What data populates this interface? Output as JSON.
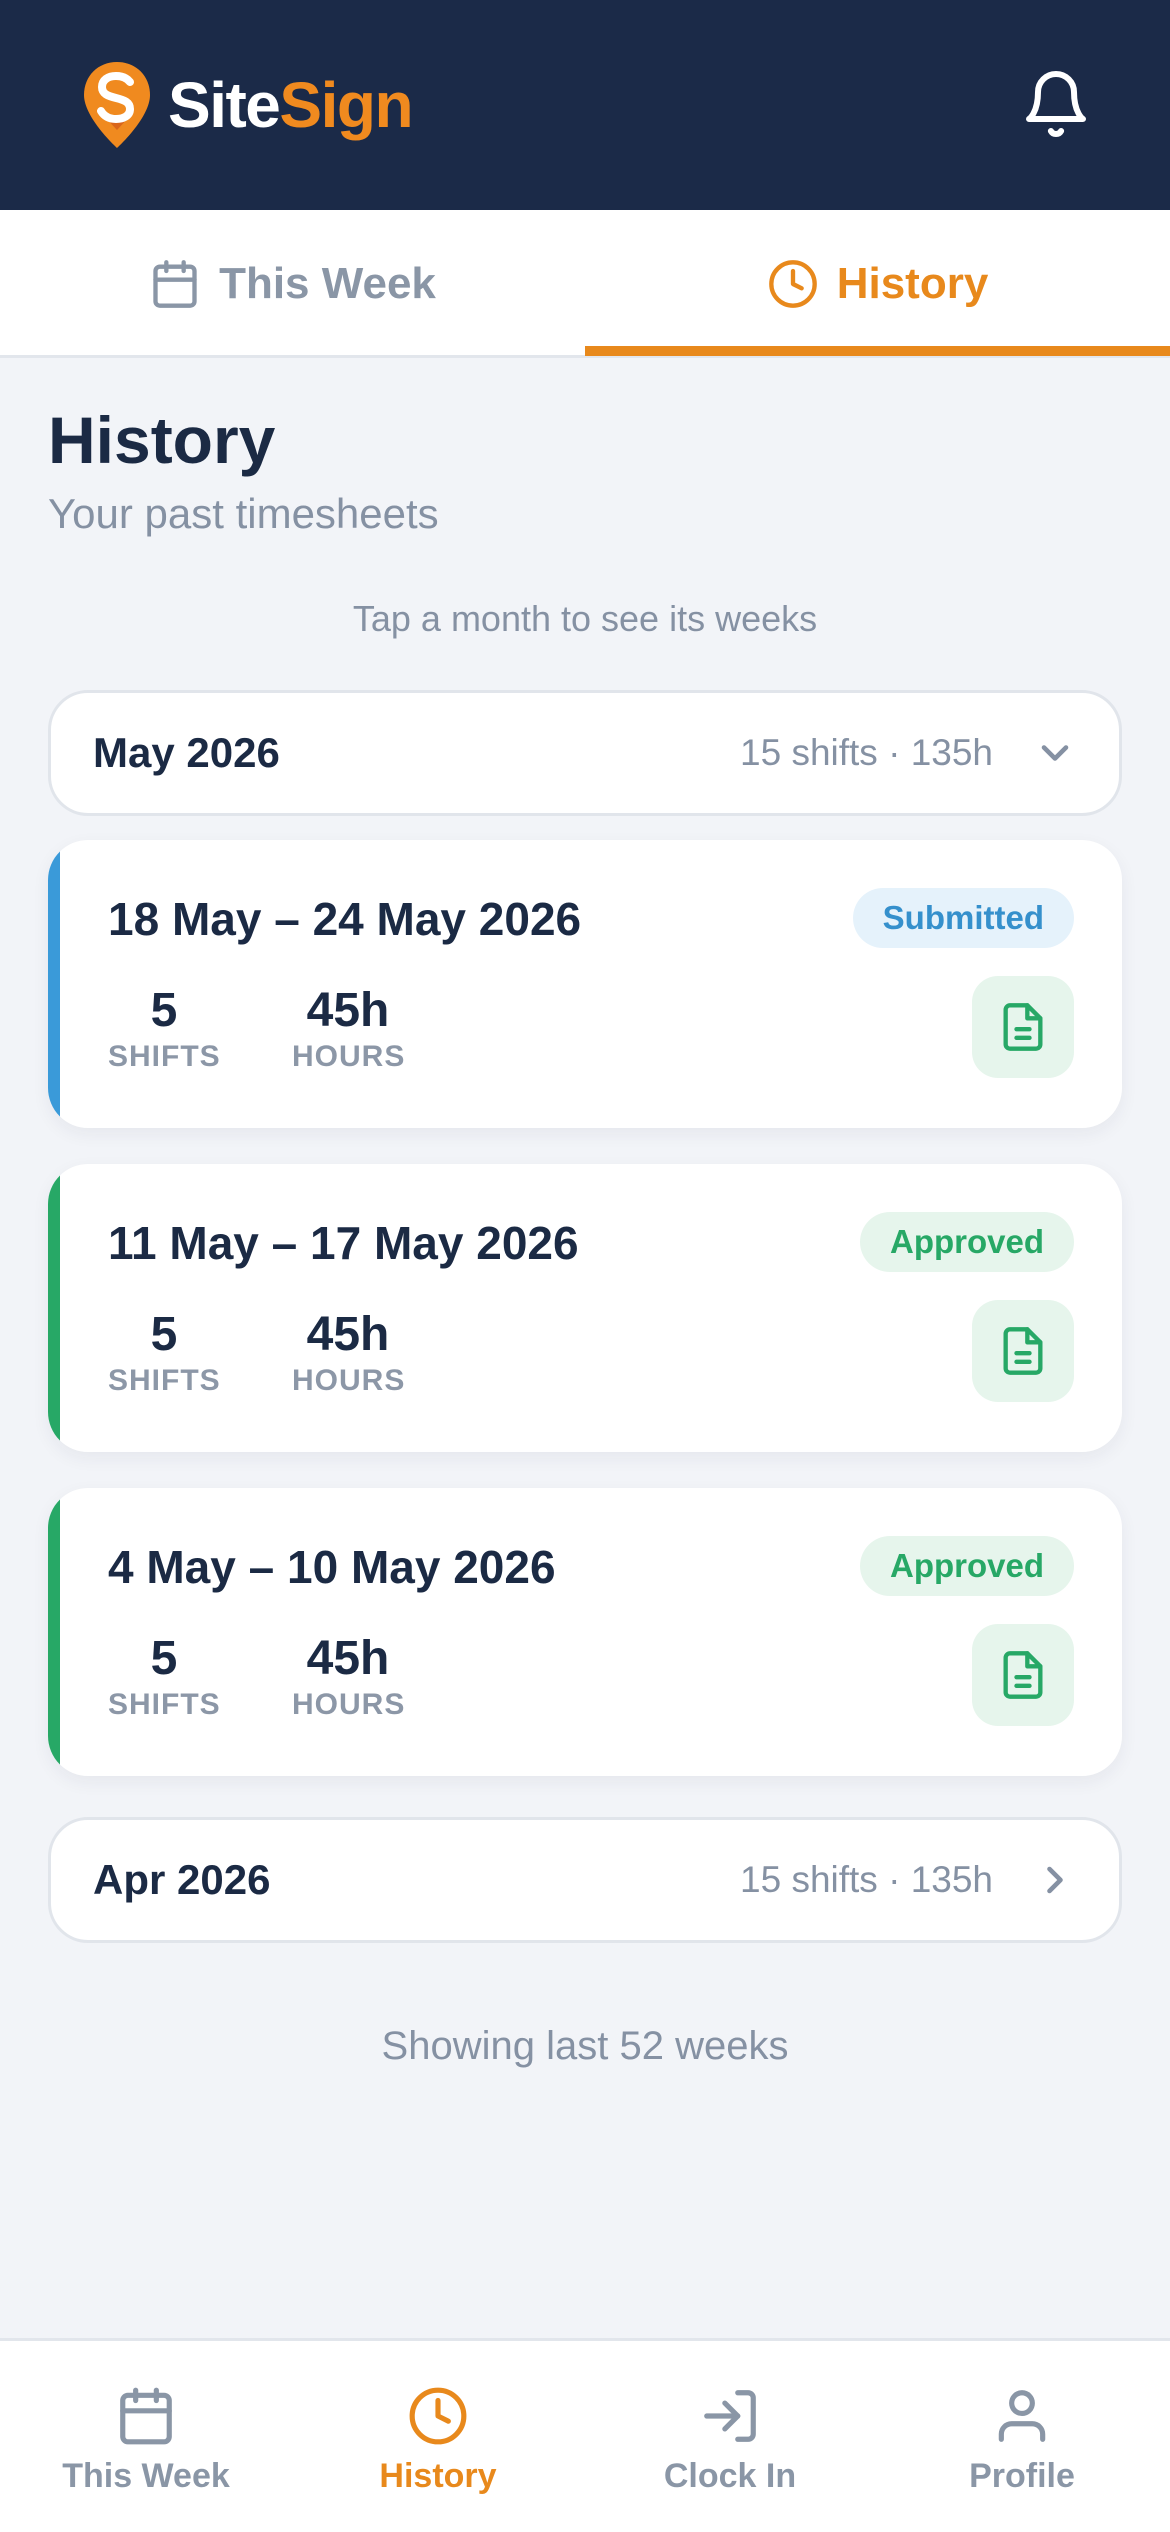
{
  "app": {
    "logo_site": "Site",
    "logo_sign": "Sign",
    "brand_color": "#f08a1f",
    "header_bg": "#1b2a48"
  },
  "tabs": [
    {
      "label": "This Week",
      "icon": "calendar-icon",
      "active": false
    },
    {
      "label": "History",
      "icon": "clock-icon",
      "active": true
    }
  ],
  "page": {
    "title": "History",
    "subtitle": "Your past timesheets",
    "hint": "Tap a month to see its weeks",
    "footer": "Showing last 52 weeks"
  },
  "months": [
    {
      "name": "May 2026",
      "meta": "15 shifts · 135h",
      "expanded": true
    },
    {
      "name": "Apr 2026",
      "meta": "15 shifts · 135h",
      "expanded": false
    }
  ],
  "weeks": [
    {
      "range": "18 May – 24 May 2026",
      "status": "Submitted",
      "status_color": "#3590cc",
      "shifts": "5",
      "shifts_label": "SHIFTS",
      "hours": "45h",
      "hours_label": "HOURS"
    },
    {
      "range": "11 May – 17 May 2026",
      "status": "Approved",
      "status_color": "#27a866",
      "shifts": "5",
      "shifts_label": "SHIFTS",
      "hours": "45h",
      "hours_label": "HOURS"
    },
    {
      "range": "4 May – 10 May 2026",
      "status": "Approved",
      "status_color": "#27a866",
      "shifts": "5",
      "shifts_label": "SHIFTS",
      "hours": "45h",
      "hours_label": "HOURS"
    }
  ],
  "bottom_nav": [
    {
      "label": "This Week",
      "icon": "calendar-icon"
    },
    {
      "label": "History",
      "icon": "clock-icon",
      "active": true
    },
    {
      "label": "Clock In",
      "icon": "login-icon"
    },
    {
      "label": "Profile",
      "icon": "user-icon"
    }
  ],
  "colors": {
    "accent": "#e8891c",
    "submitted": "#3a9ad9",
    "approved": "#27a866"
  }
}
